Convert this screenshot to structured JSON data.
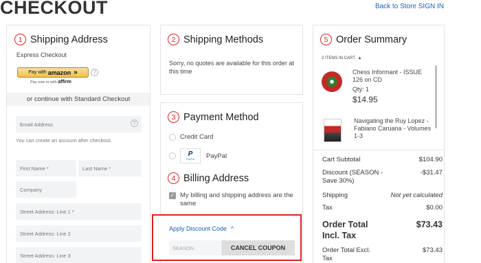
{
  "page": {
    "title": "CHECKOUT"
  },
  "header_links": {
    "back_to_store": "Back to Store",
    "sign_in": "SIGN IN"
  },
  "shipping_address": {
    "number": "1",
    "heading": "Shipping Address",
    "express_checkout": "Express Checkout",
    "amazon_pay_with": "Pay with",
    "amazon_brand": "amazon",
    "amazon_arrow": "»",
    "affirm_text": "Pay now or with",
    "affirm_brand": "affirm",
    "or_continue": "or continue with Standard Checkout",
    "email_placeholder": "Email Address",
    "email_hint": "You can create an account after checkout.",
    "first_name_placeholder": "First Name *",
    "last_name_placeholder": "Last Name *",
    "company_placeholder": "Company",
    "street1_placeholder": "Street Address: Line 1 *",
    "street2_placeholder": "Street Address: Line 2",
    "street3_placeholder": "Street Address: Line 3"
  },
  "shipping_methods": {
    "number": "2",
    "heading": "Shipping Methods",
    "message": "Sorry, no quotes are available for this order at this time"
  },
  "payment_method": {
    "number": "3",
    "heading": "Payment Method",
    "options": [
      {
        "label": "Credit Card"
      },
      {
        "label": "PayPal"
      }
    ]
  },
  "billing_address": {
    "number": "4",
    "heading": "Billing Address",
    "same_as_shipping": "My billing and shipping address are the same"
  },
  "discount": {
    "toggle_label": "Apply Discount Code",
    "toggle_arrow": "^",
    "code_value": "SEASON",
    "cancel_label": "CANCEL COUPON"
  },
  "order_summary": {
    "number": "5",
    "heading": "Order Summary",
    "items_in_cart": "2 ITEMS IN CART",
    "items": [
      {
        "name": "Chess Informant - ISSUE 126 on CD",
        "qty": "Qty: 1",
        "price": "$14.95"
      },
      {
        "name": "Navigating the Ruy Lopez - Fabiano Caruana - Volumes 1-3"
      }
    ],
    "cart_subtotal_label": "Cart Subtotal",
    "cart_subtotal_value": "$104.90",
    "discount_label": "Discount (SEASON - Save 30%)",
    "discount_value": "-$31.47",
    "shipping_label": "Shipping",
    "shipping_value": "Not yet calculated",
    "tax_label": "Tax",
    "tax_value": "$0.00",
    "order_total_label": "Order Total Incl. Tax",
    "order_total_value": "$73.43",
    "order_total_excl_label": "Order Total Excl. Tax",
    "order_total_excl_value": "$73.43"
  },
  "colors": {
    "accent_red": "#e02020",
    "link_blue": "#1a5fb4",
    "amazon_gold": "#f0c14b"
  }
}
